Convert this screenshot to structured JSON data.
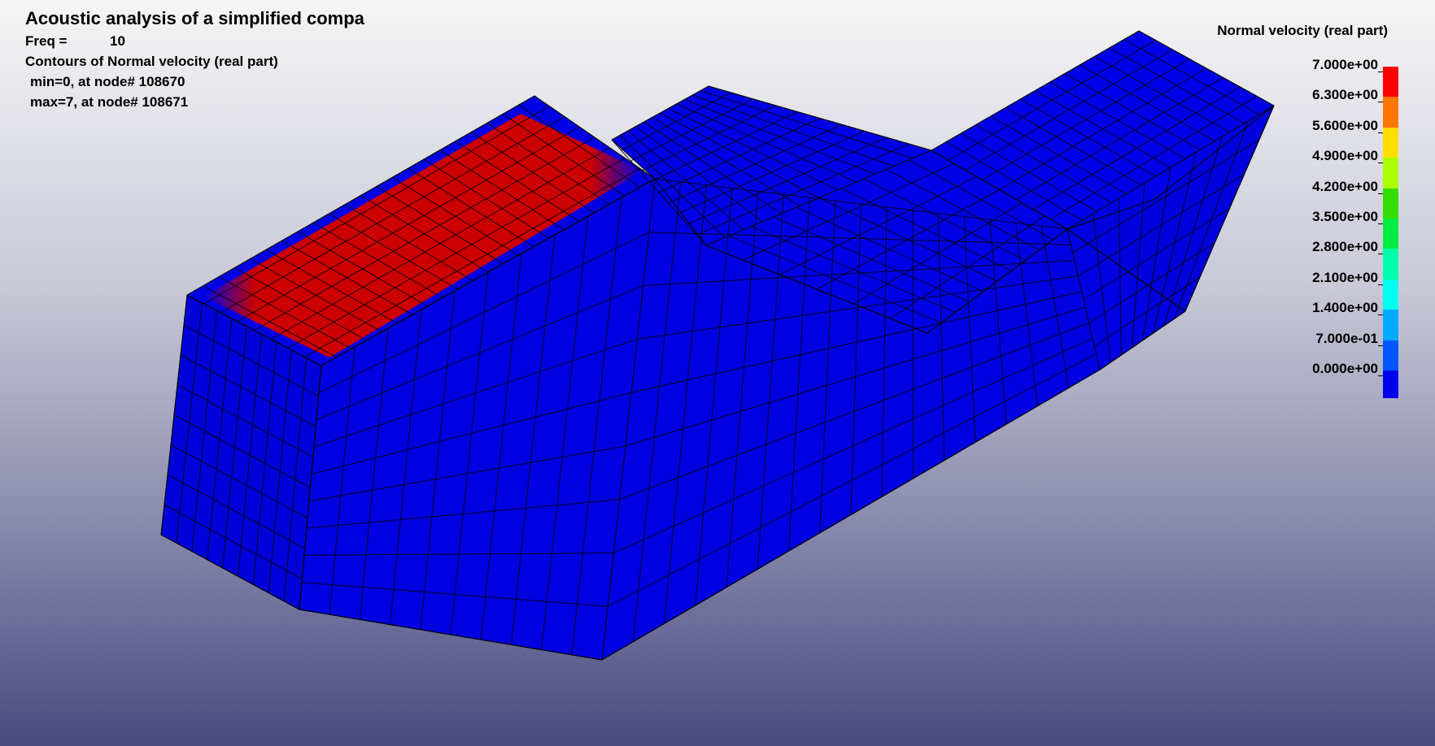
{
  "header": {
    "title": "Acoustic analysis of a simplified compa",
    "freq_label": "Freq =",
    "freq_value": "10",
    "contours_line": "Contours of Normal velocity (real part)",
    "min_line": "min=0, at node# 108670",
    "max_line": "max=7, at node# 108671"
  },
  "legend": {
    "title": "Normal velocity (real part)",
    "labels": [
      "7.000e+00",
      "6.300e+00",
      "5.600e+00",
      "4.900e+00",
      "4.200e+00",
      "3.500e+00",
      "2.800e+00",
      "2.100e+00",
      "1.400e+00",
      "7.000e-01",
      "0.000e+00"
    ],
    "colors": [
      "#ff0000",
      "#ff7700",
      "#ffdd00",
      "#aaff00",
      "#33dd00",
      "#00ee44",
      "#00ffaa",
      "#00ffee",
      "#00aaff",
      "#0055ff",
      "#0000ee"
    ]
  },
  "model": {
    "base_color": "#0000dd",
    "hot_color": "#cc0000",
    "edge_color": "#000000"
  }
}
